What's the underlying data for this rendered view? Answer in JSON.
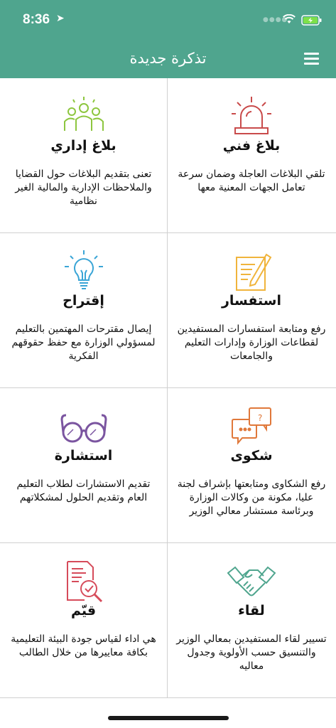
{
  "status_bar": {
    "time": "8:36"
  },
  "header": {
    "title": "تذكرة جديدة"
  },
  "tiles": [
    {
      "title": "بلاغ فني",
      "description": "تلقي البلاغات العاجلة وضمان سرعة تعامل الجهات المعنية معها",
      "icon": "siren-icon",
      "color": "#c94b4b"
    },
    {
      "title": "بلاغ إداري",
      "description": "تعنى بتقديم البلاغات حول القضايا والملاحظات الإدارية والمالية الغير نظامية",
      "icon": "people-icon",
      "color": "#8dc63f"
    },
    {
      "title": "استفسار",
      "description": "رفع ومتابعة استفسارات المستفيدين لقطاعات الوزارة وإدارات التعليم والجامعات",
      "icon": "note-pencil-icon",
      "color": "#f0b43c"
    },
    {
      "title": "إقتراح",
      "description": "إيصال مقترحات المهتمين بالتعليم لمسؤولي الوزارة مع حفظ حقوقهم الفكرية",
      "icon": "lightbulb-icon",
      "color": "#3aa5d6"
    },
    {
      "title": "شكوى",
      "description": "رفع الشكاوى ومتابعتها بإشراف لجنة عليا، مكونة من وكالات الوزارة وبرئاسة مستشار معالي الوزير",
      "icon": "chat-bubbles-icon",
      "color": "#e0783a"
    },
    {
      "title": "استشارة",
      "description": "تقديم الاستشارات لطلاب التعليم العام وتقديم الحلول لمشكلاتهم",
      "icon": "glasses-icon",
      "color": "#7b55a0"
    },
    {
      "title": "لقاء",
      "description": "تسيير لقاء المستفيدين بمعالي الوزير والتنسيق حسب الأولوية وجدول معاليه",
      "icon": "handshake-icon",
      "color": "#4fa58e"
    },
    {
      "title": "قيّم",
      "description": "هي اداء لقياس جودة البيئة التعليمية بكافة معاييرها من خلال الطالب",
      "icon": "checklist-magnifier-icon",
      "color": "#d64b5a"
    }
  ]
}
